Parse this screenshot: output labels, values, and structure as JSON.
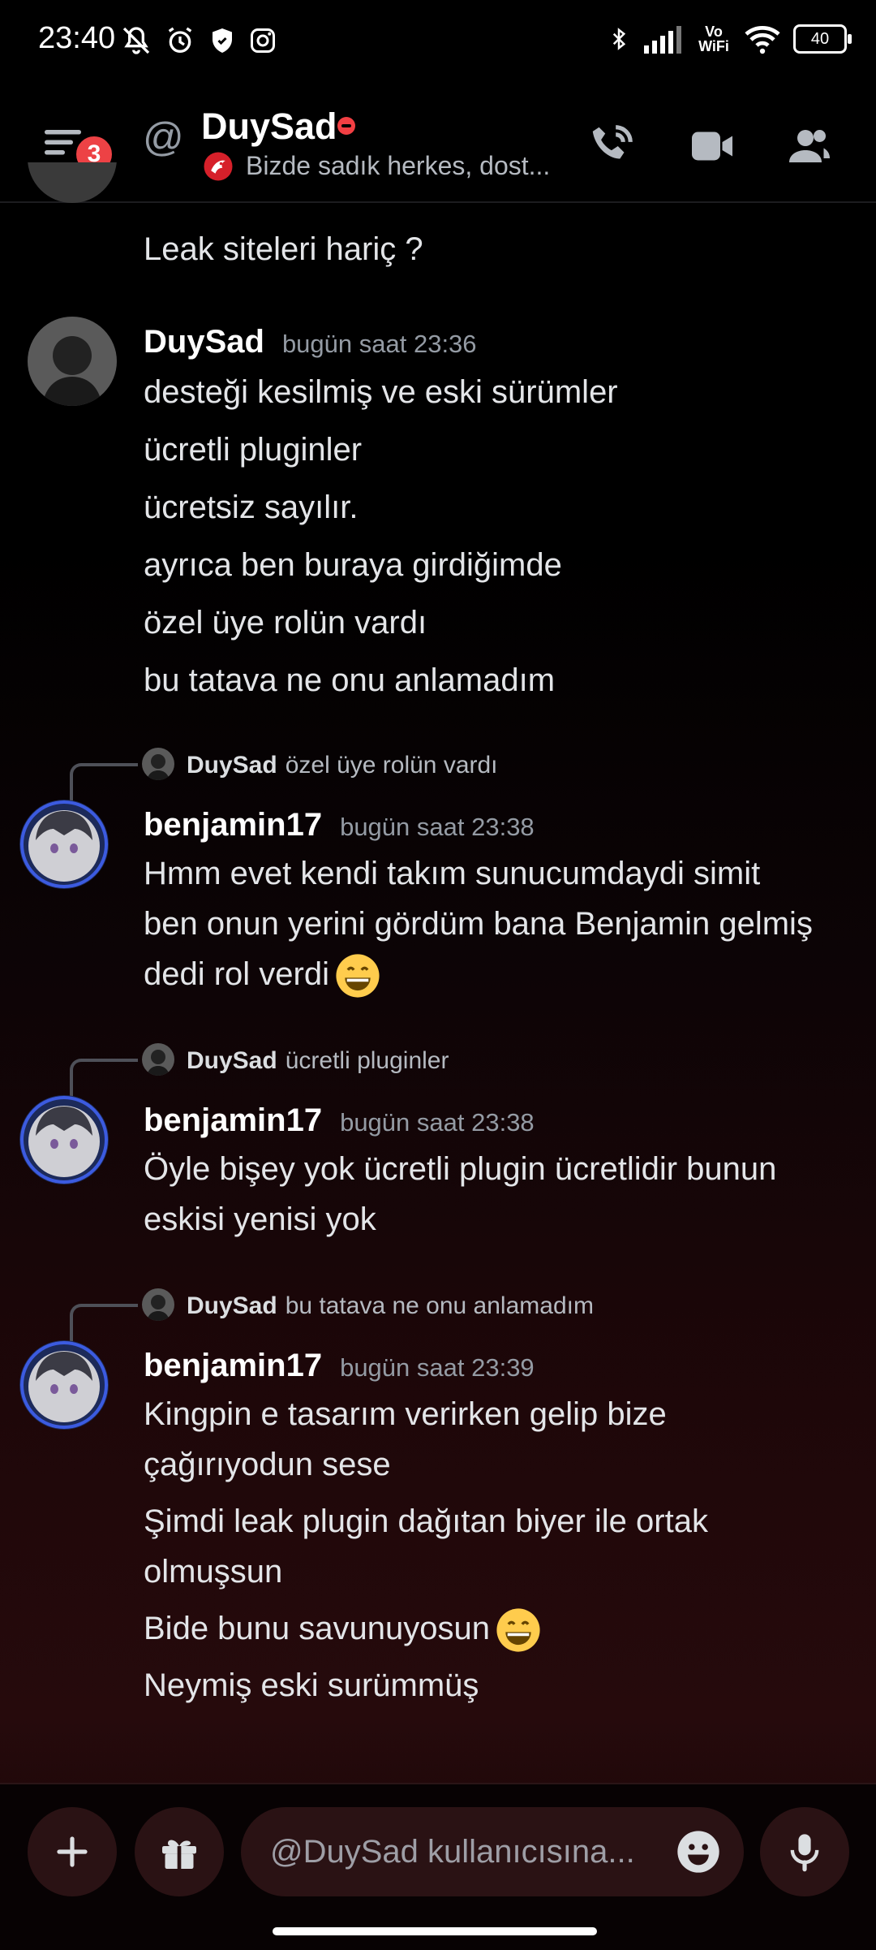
{
  "status_bar": {
    "time": "23:40",
    "battery": "40",
    "vowifi": "Vo WiFi",
    "icons_left": [
      "bell-off-icon",
      "alarm-icon",
      "shield-icon",
      "instagram-icon"
    ],
    "icons_right": [
      "bluetooth-icon",
      "signal-icon",
      "vowifi-icon",
      "wifi-icon",
      "battery-icon"
    ]
  },
  "header": {
    "notification_count": "3",
    "title": "DuySad",
    "status_text": "Bizde sadık herkes, dost...",
    "buttons": [
      "phone-icon",
      "video-icon",
      "members-icon"
    ]
  },
  "messages": {
    "m0": {
      "text": "Leak siteleri hariç ?"
    },
    "m1": {
      "author": "DuySad",
      "timestamp": "bugün saat 23:36",
      "lines": [
        "desteği kesilmiş ve eski sürümler",
        "ücretli pluginler",
        "ücretsiz sayılır.",
        "ayrıca ben buraya girdiğimde",
        "özel üye rolün vardı",
        "bu tatava ne onu anlamadım"
      ]
    },
    "m2": {
      "reply_author": "DuySad",
      "reply_text": "özel üye rolün vardı",
      "author": "benjamin17",
      "timestamp": "bugün saat 23:38",
      "lines": [
        "Hmm evet kendi takım sunucumdaydi simit",
        "ben onun yerini gördüm bana Benjamin gelmiş",
        "dedi rol verdi"
      ]
    },
    "m3": {
      "reply_author": "DuySad",
      "reply_text": "ücretli pluginler",
      "author": "benjamin17",
      "timestamp": "bugün saat 23:38",
      "lines": [
        "Öyle bişey yok ücretli plugin ücretlidir bunun",
        "eskisi yenisi yok"
      ]
    },
    "m4": {
      "reply_author": "DuySad",
      "reply_text": "bu tatava ne onu anlamadım",
      "author": "benjamin17",
      "timestamp": "bugün saat 23:39",
      "lines": [
        "Kingpin e tasarım verirken gelip bize",
        "çağırıyodun sese",
        "Şimdi leak plugin dağıtan biyer ile ortak",
        "olmuşsun",
        "Bide bunu savunuyosun",
        "Neymiş eski surümmüş"
      ]
    }
  },
  "composer": {
    "placeholder": "@DuySad kullanıcısına...",
    "buttons": [
      "plus-icon",
      "gift-icon",
      "emoji-icon",
      "microphone-icon"
    ]
  },
  "colors": {
    "accent_red": "#ed4245",
    "text_primary": "#f2f3f5",
    "text_muted": "#949ba4"
  }
}
